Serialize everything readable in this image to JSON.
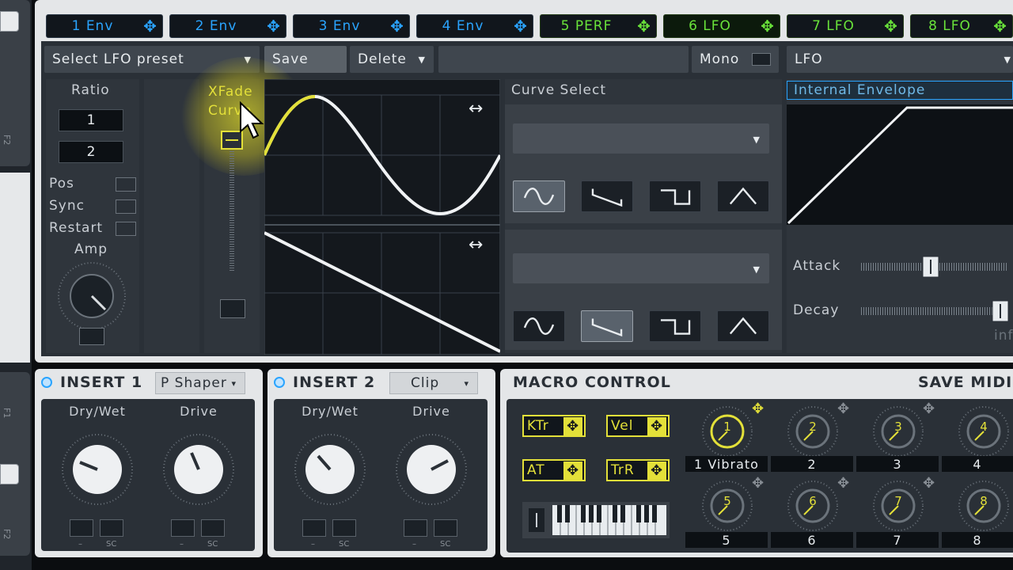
{
  "tabs": [
    {
      "label": "1 Env",
      "kind": "env"
    },
    {
      "label": "2 Env",
      "kind": "env"
    },
    {
      "label": "3 Env",
      "kind": "env"
    },
    {
      "label": "4 Env",
      "kind": "env"
    },
    {
      "label": "5 PERF",
      "kind": "perf"
    },
    {
      "label": "6 LFO",
      "kind": "lfo",
      "selected": true
    },
    {
      "label": "7 LFO",
      "kind": "lfo"
    },
    {
      "label": "8 LFO",
      "kind": "lfo"
    }
  ],
  "move_icon": "✥",
  "preset": {
    "dropdown": "Select LFO preset",
    "save": "Save",
    "delete": "Delete",
    "mono": "Mono",
    "mode": "LFO"
  },
  "lfo_panel": {
    "ratio_label": "Ratio",
    "ratio_top": "1",
    "ratio_bottom": "2",
    "pos": "Pos",
    "sync": "Sync",
    "restart": "Restart",
    "amp": "Amp",
    "xfade_line1": "XFade",
    "xfade_line2": "Curve"
  },
  "curve_select": {
    "title": "Curve Select"
  },
  "envelope": {
    "dropdown": "Internal Envelope",
    "attack": "Attack",
    "decay": "Decay",
    "inf_partial": "inf"
  },
  "insert1": {
    "title": "INSERT 1",
    "type": "P Shaper",
    "dry_wet": "Dry/Wet",
    "drive": "Drive",
    "dash": "–",
    "sc": "SC"
  },
  "insert2": {
    "title": "INSERT 2",
    "type": "Clip",
    "dry_wet": "Dry/Wet",
    "drive": "Drive",
    "dash": "–",
    "sc": "SC"
  },
  "macro": {
    "title": "MACRO CONTROL",
    "save_midi": "SAVE MIDI",
    "buttons": [
      "KTr",
      "Vel",
      "AT",
      "TrR"
    ],
    "knobs": [
      {
        "num": "1",
        "label": "1 Vibrato"
      },
      {
        "num": "2",
        "label": "2"
      },
      {
        "num": "3",
        "label": "3"
      },
      {
        "num": "4",
        "label": "4"
      },
      {
        "num": "5",
        "label": "5"
      },
      {
        "num": "6",
        "label": "6"
      },
      {
        "num": "7",
        "label": "7"
      },
      {
        "num": "8",
        "label": "8"
      }
    ]
  },
  "left_strip": {
    "f2_top": "F2",
    "f1": "F1",
    "f2_bottom": "F2"
  },
  "colors": {
    "env": "#2aa4ff",
    "lfo": "#69e23a",
    "macro": "#e3e039"
  }
}
